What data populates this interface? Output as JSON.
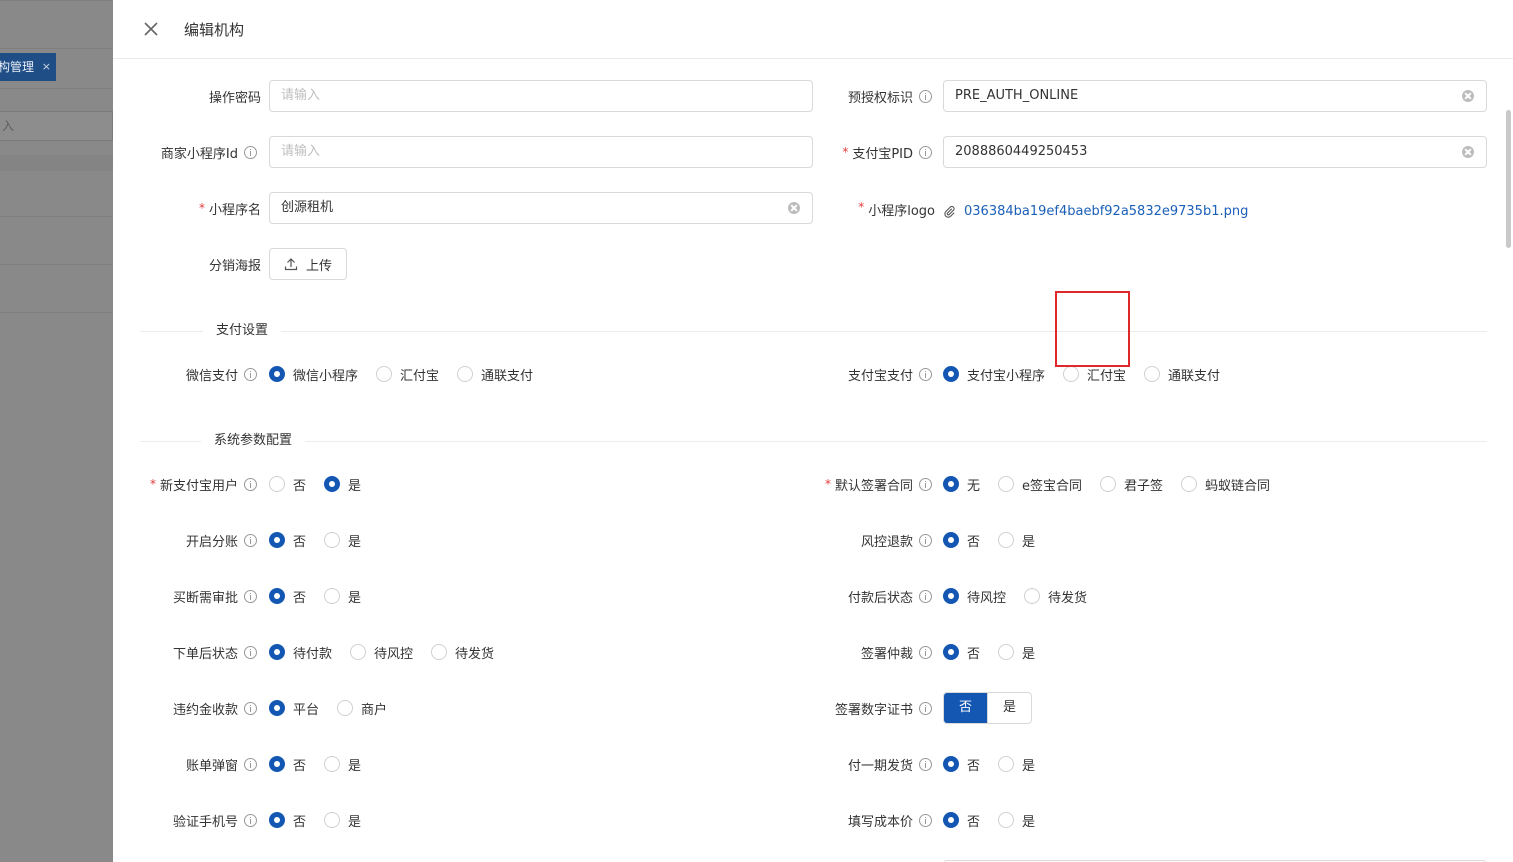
{
  "background": {
    "tab_label": "构管理",
    "tab_close": "×",
    "input_placeholder": "入"
  },
  "drawer": {
    "title": "编辑机构"
  },
  "form": {
    "operation_password": {
      "label": "操作密码",
      "placeholder": "请输入"
    },
    "pre_auth_flag": {
      "label": "预授权标识",
      "value": "PRE_AUTH_ONLINE"
    },
    "merchant_miniapp_id": {
      "label": "商家小程序Id",
      "placeholder": "请输入"
    },
    "alipay_pid": {
      "label": "支付宝PID",
      "value": "2088860449250453"
    },
    "miniapp_name": {
      "label": "小程序名",
      "value": "创源租机"
    },
    "miniapp_logo": {
      "label": "小程序logo",
      "file": "036384ba19ef4baebf92a5832e9735b1.png"
    },
    "distribution_poster": {
      "label": "分销海报",
      "button": "上传"
    }
  },
  "sections": {
    "payment": "支付设置",
    "system": "系统参数配置"
  },
  "payment": {
    "wechat": {
      "label": "微信支付",
      "options": [
        "微信小程序",
        "汇付宝",
        "通联支付"
      ],
      "selected": 0
    },
    "alipay": {
      "label": "支付宝支付",
      "options": [
        "支付宝小程序",
        "汇付宝",
        "通联支付"
      ],
      "selected": 0
    }
  },
  "system": {
    "left": [
      {
        "label": "新支付宝用户",
        "required": true,
        "options": [
          "否",
          "是"
        ],
        "selected": 1
      },
      {
        "label": "开启分账",
        "options": [
          "否",
          "是"
        ],
        "selected": 0
      },
      {
        "label": "买断需审批",
        "options": [
          "否",
          "是"
        ],
        "selected": 0
      },
      {
        "label": "下单后状态",
        "options": [
          "待付款",
          "待风控",
          "待发货"
        ],
        "selected": 0
      },
      {
        "label": "违约金收款",
        "options": [
          "平台",
          "商户"
        ],
        "selected": 0
      },
      {
        "label": "账单弹窗",
        "options": [
          "否",
          "是"
        ],
        "selected": 0
      },
      {
        "label": "验证手机号",
        "options": [
          "否",
          "是"
        ],
        "selected": 0
      }
    ],
    "right": [
      {
        "label": "默认签署合同",
        "required": true,
        "options": [
          "无",
          "e签宝合同",
          "君子签",
          "蚂蚁链合同"
        ],
        "selected": 0
      },
      {
        "label": "风控退款",
        "options": [
          "否",
          "是"
        ],
        "selected": 0
      },
      {
        "label": "付款后状态",
        "options": [
          "待风控",
          "待发货"
        ],
        "selected": 0
      },
      {
        "label": "签署仲裁",
        "options": [
          "否",
          "是"
        ],
        "selected": 0
      },
      {
        "label": "签署数字证书",
        "options": [
          "否",
          "是"
        ],
        "selected": 0,
        "segmented": true
      },
      {
        "label": "付一期发货",
        "options": [
          "否",
          "是"
        ],
        "selected": 0
      },
      {
        "label": "填写成本价",
        "options": [
          "否",
          "是"
        ],
        "selected": 0
      }
    ]
  },
  "colors": {
    "primary": "#1457b3",
    "required": "#e23b3b",
    "highlight": "#e0282a"
  }
}
